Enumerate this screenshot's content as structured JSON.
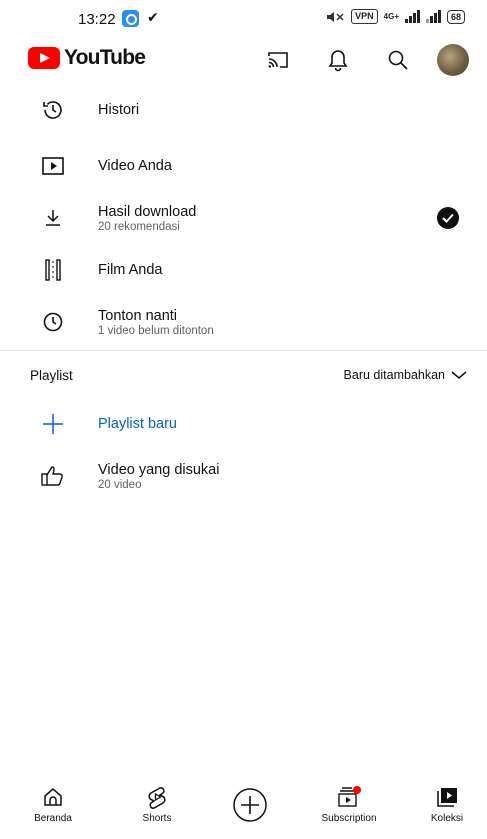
{
  "status_bar": {
    "time": "13:22",
    "check_glyph": "✔",
    "vpn": "VPN",
    "network": "4G+",
    "battery": "68"
  },
  "header": {
    "logo_text": "YouTube",
    "icons": [
      "cast-icon",
      "bell-icon",
      "search-icon",
      "avatar"
    ]
  },
  "library": {
    "items": [
      {
        "title": "Histori",
        "subtitle": "",
        "icon": "history-icon"
      },
      {
        "title": "Video Anda",
        "subtitle": "",
        "icon": "video-icon"
      },
      {
        "title": "Hasil download",
        "subtitle": "20 rekomendasi",
        "icon": "download-icon"
      },
      {
        "title": "Film Anda",
        "subtitle": "",
        "icon": "film-icon"
      },
      {
        "title": "Tonton nanti",
        "subtitle": "1 video belum ditonton",
        "icon": "clock-icon"
      }
    ]
  },
  "playlist": {
    "title": "Playlist",
    "sort_label": "Baru ditambahkan",
    "items": [
      {
        "title": "Playlist baru",
        "subtitle": "",
        "icon": "plus-icon"
      },
      {
        "title": "Video yang disukai",
        "subtitle": "20 video",
        "icon": "thumb-up-icon"
      }
    ]
  },
  "bottom_nav": {
    "items": [
      {
        "label": "Beranda",
        "icon": "home-icon"
      },
      {
        "label": "Shorts",
        "icon": "shorts-icon"
      },
      {
        "label": "",
        "icon": "create-icon"
      },
      {
        "label": "Subscription",
        "icon": "subscriptions-icon"
      },
      {
        "label": "Koleksi",
        "icon": "library-icon"
      }
    ]
  },
  "colors": {
    "brand": "#ff0000",
    "accent_blue": "#065fd4",
    "notification_dot": "#ff0000"
  }
}
